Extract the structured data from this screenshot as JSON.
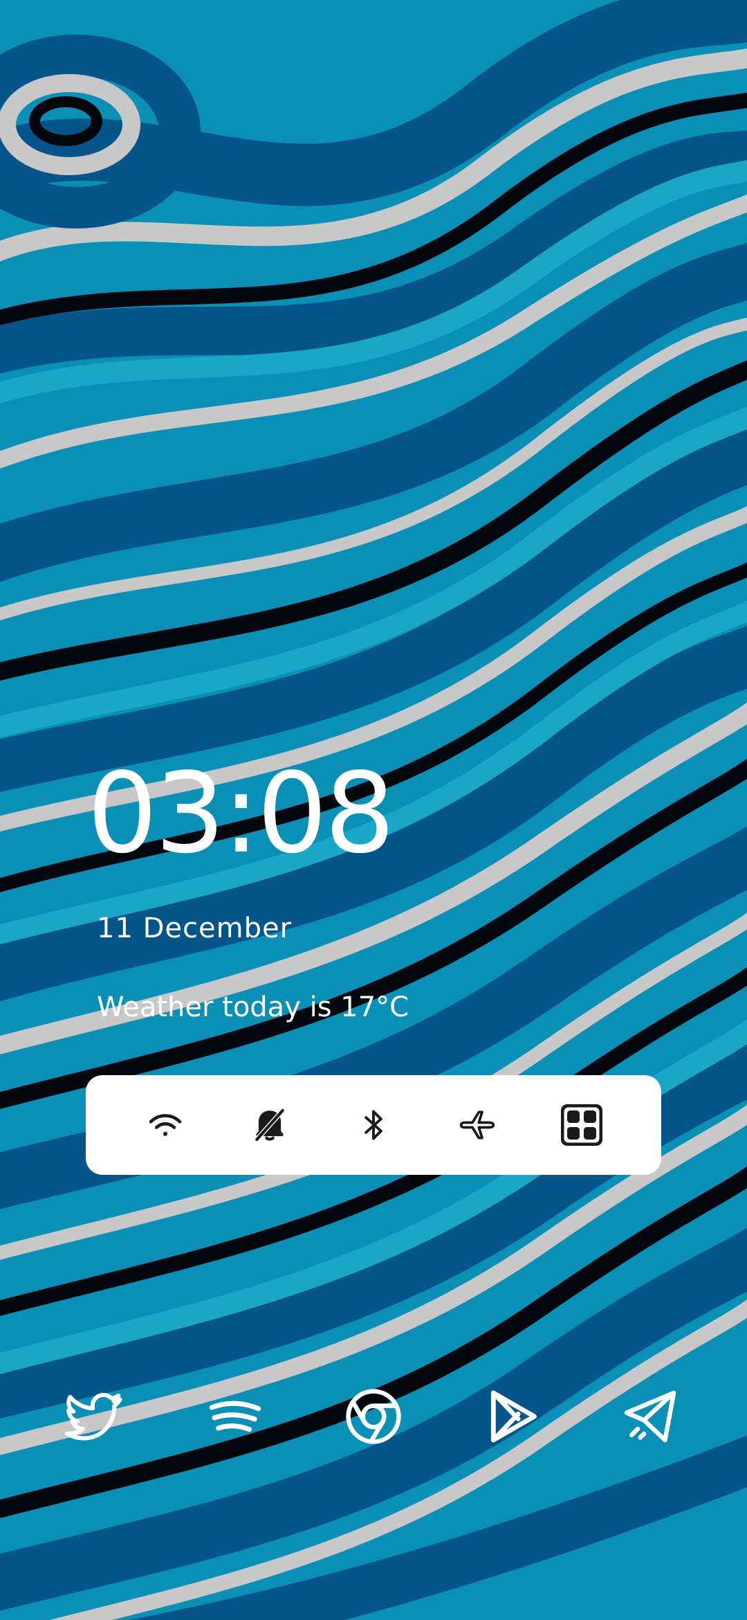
{
  "lockscreen": {
    "time": "03:08",
    "date": "11 December",
    "weather": "Weather today is 17°C"
  },
  "quick_toggles": [
    {
      "name": "wifi-icon"
    },
    {
      "name": "bell-off-icon"
    },
    {
      "name": "bluetooth-icon"
    },
    {
      "name": "airplane-icon"
    },
    {
      "name": "app-grid-icon"
    }
  ],
  "dock": [
    {
      "name": "twitter-icon"
    },
    {
      "name": "spotify-icon"
    },
    {
      "name": "chrome-icon"
    },
    {
      "name": "play-store-icon"
    },
    {
      "name": "telegram-icon"
    }
  ],
  "colors": {
    "wallpaper_dark": "#045a88",
    "wallpaper_mid": "#0a93b8",
    "wallpaper_light": "#c9c9c9",
    "wallpaper_black": "#03060a",
    "toggle_bar": "#ffffff",
    "icon_dark": "#1a1a1a"
  }
}
